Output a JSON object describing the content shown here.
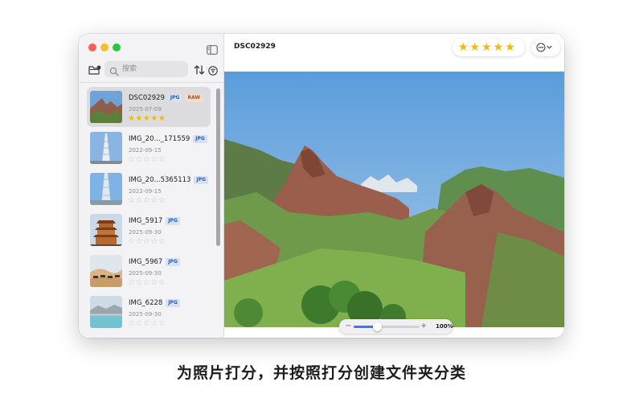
{
  "window": {
    "title": "DSC02929",
    "rating_stars": "★★★★★",
    "zoom": {
      "level": 0.35,
      "label": "100%",
      "minus": "−",
      "plus": "+"
    }
  },
  "sidebar": {
    "search_placeholder": "搜索",
    "items": [
      {
        "name": "DSC02929",
        "badges": [
          "JPG",
          "RAW"
        ],
        "date": "2025-07-09",
        "stars": "★★★★★",
        "rating": 5,
        "selected": true
      },
      {
        "name": "IMG_20..._171559",
        "badges": [
          "JPG"
        ],
        "date": "2022-09-15",
        "stars": "☆☆☆☆☆",
        "rating": 0
      },
      {
        "name": "IMG_20...5365113",
        "badges": [
          "JPG"
        ],
        "date": "2022-09-15",
        "stars": "☆☆☆☆☆",
        "rating": 0
      },
      {
        "name": "IMG_5917",
        "badges": [
          "JPG"
        ],
        "date": "2025-09-30",
        "stars": "☆☆☆☆☆",
        "rating": 0
      },
      {
        "name": "IMG_5967",
        "badges": [
          "JPG"
        ],
        "date": "2025-09-30",
        "stars": "☆☆☆☆☆",
        "rating": 0
      },
      {
        "name": "IMG_6228",
        "badges": [
          "JPG"
        ],
        "date": "2025-09-30",
        "stars": "☆☆☆☆☆",
        "rating": 0
      }
    ]
  },
  "caption": "为照片打分，并按照打分创建文件夹分类",
  "icons": {
    "sidebar_toggle": "sidebar-toggle-icon",
    "folder": "folder-badge-icon",
    "search": "search-icon",
    "sort": "sort-arrows-icon",
    "filter": "filter-circle-icon",
    "more": "ellipsis-circle-icon",
    "chevron": "chevron-down-icon"
  },
  "colors": {
    "accent": "#2f7cf6",
    "star": "#f5b800",
    "jpg_badge": "#d5e1f5",
    "raw_badge": "#f5dccc"
  }
}
